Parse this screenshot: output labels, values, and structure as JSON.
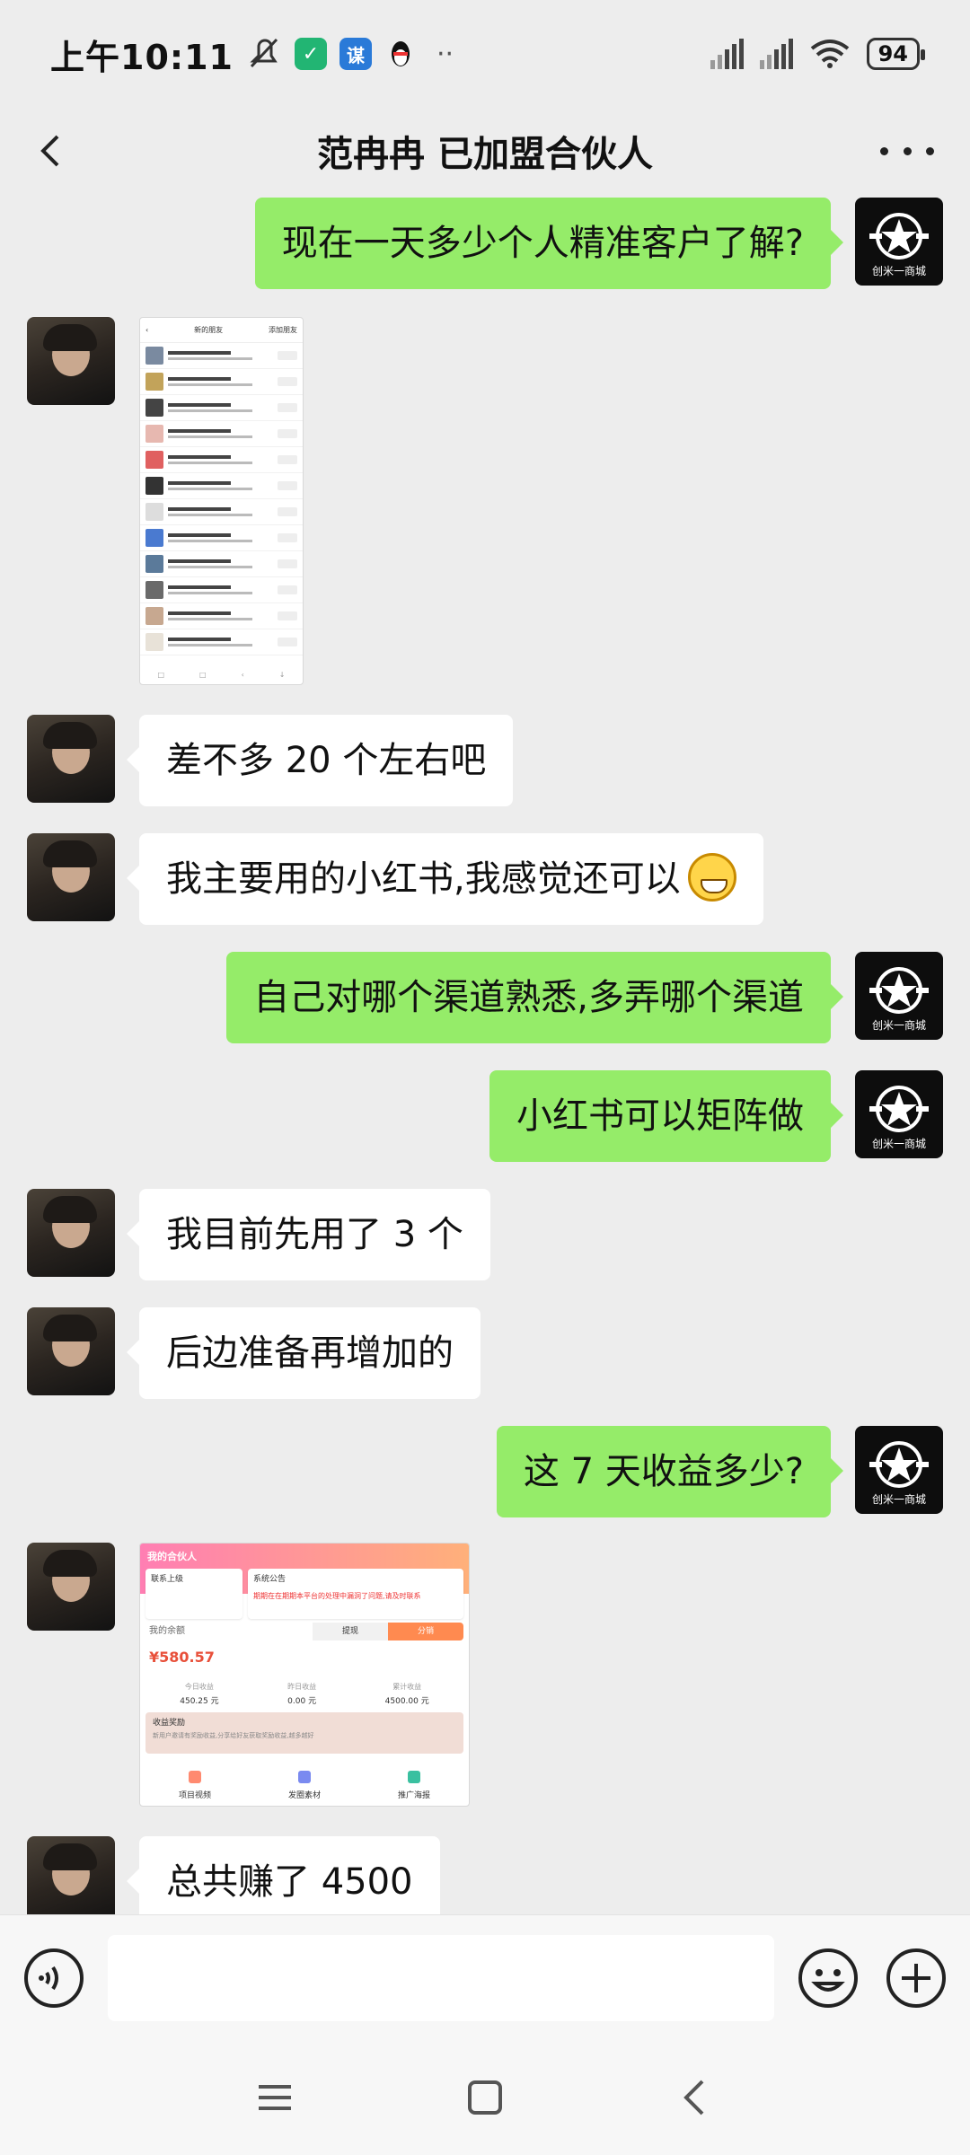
{
  "status_bar": {
    "time": "上午10:11",
    "app_badge": "谋",
    "battery": "94"
  },
  "header": {
    "title": "范冉冉 已加盟合伙人"
  },
  "contact_avatar_label": "创米一商城",
  "messages": [
    {
      "from": "me",
      "type": "text",
      "text": "现在一天多少个人精准客户了解?"
    },
    {
      "from": "other",
      "type": "image",
      "image": "contacts-list-screenshot"
    },
    {
      "from": "other",
      "type": "text",
      "text": "差不多 20 个左右吧"
    },
    {
      "from": "other",
      "type": "text",
      "text": "我主要用的小红书,我感觉还可以",
      "emoji": "grinning-face"
    },
    {
      "from": "me",
      "type": "text",
      "text": "自己对哪个渠道熟悉,多弄哪个渠道"
    },
    {
      "from": "me",
      "type": "text",
      "text": "小红书可以矩阵做"
    },
    {
      "from": "other",
      "type": "text",
      "text": "我目前先用了 3 个"
    },
    {
      "from": "other",
      "type": "text",
      "text": "后边准备再增加的"
    },
    {
      "from": "me",
      "type": "text",
      "text": "这 7 天收益多少?"
    },
    {
      "from": "other",
      "type": "image",
      "image": "earnings-screenshot"
    },
    {
      "from": "other",
      "type": "text",
      "text": "总共赚了 4500"
    }
  ],
  "screenshot_contacts": {
    "title": "新的朋友",
    "action": "添加朋友"
  },
  "screenshot_earnings": {
    "banner": "我的合伙人",
    "card_left": "联系上级",
    "card_right_title": "系统公告",
    "card_right_text": "期期在在期期本平台的处理中漏洞了问题,请及时联系",
    "balance_label": "我的余额",
    "balance": "¥580.57",
    "tab_withdraw": "提现",
    "tab_invite": "分销",
    "stats": [
      {
        "label": "今日收益",
        "value": "450.25 元"
      },
      {
        "label": "昨日收益",
        "value": "0.00 元"
      },
      {
        "label": "累计收益",
        "value": "4500.00 元"
      }
    ],
    "reward_title": "收益奖励",
    "reward_text": "新用户邀请有奖励收益,分享给好友获取奖励收益,越多越好",
    "bottom_items": [
      "项目视频",
      "发圈素材",
      "推广海报"
    ]
  },
  "colors": {
    "my_bubble": "#95ec69",
    "other_bubble": "#ffffff",
    "background": "#ededed"
  }
}
